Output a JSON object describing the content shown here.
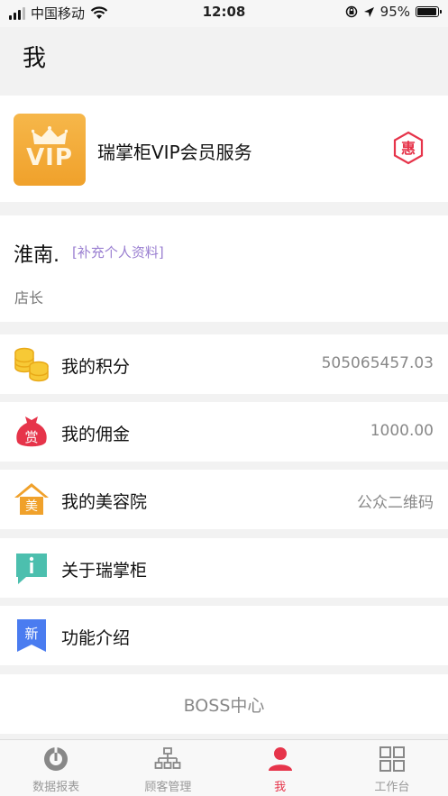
{
  "status_bar": {
    "carrier": "中国移动",
    "time": "12:08",
    "battery": "95%",
    "battery_level": 0.95
  },
  "nav": {
    "title": "我"
  },
  "vip": {
    "badge_text": "VIP",
    "title": "瑞掌柜VIP会员服务",
    "discount_char": "惠"
  },
  "profile": {
    "name": "淮南.",
    "edit_link": "[补充个人资料]",
    "role": "店长"
  },
  "menu": [
    {
      "label": "我的积分",
      "value": "505065457.03",
      "icon": "coins-icon"
    },
    {
      "label": "我的佣金",
      "value": "1000.00",
      "icon": "reward-bag-icon",
      "icon_char": "赏"
    },
    {
      "label": "我的美容院",
      "value": "公众二维码",
      "icon": "salon-house-icon",
      "icon_char": "美"
    },
    {
      "label": "关于瑞掌柜",
      "value": "",
      "icon": "info-icon"
    },
    {
      "label": "功能介绍",
      "value": "",
      "icon": "new-ribbon-icon",
      "icon_char": "新"
    }
  ],
  "boss": {
    "label": "BOSS中心"
  },
  "tabs": [
    {
      "label": "数据报表",
      "icon": "report-icon",
      "active": false
    },
    {
      "label": "顾客管理",
      "icon": "hierarchy-icon",
      "active": false
    },
    {
      "label": "我",
      "icon": "user-icon",
      "active": true
    },
    {
      "label": "工作台",
      "icon": "grid-icon",
      "active": false
    }
  ],
  "colors": {
    "accent": "#e6344a",
    "vip_gold": "#f0a12b",
    "link_purple": "#9a7fd1"
  }
}
